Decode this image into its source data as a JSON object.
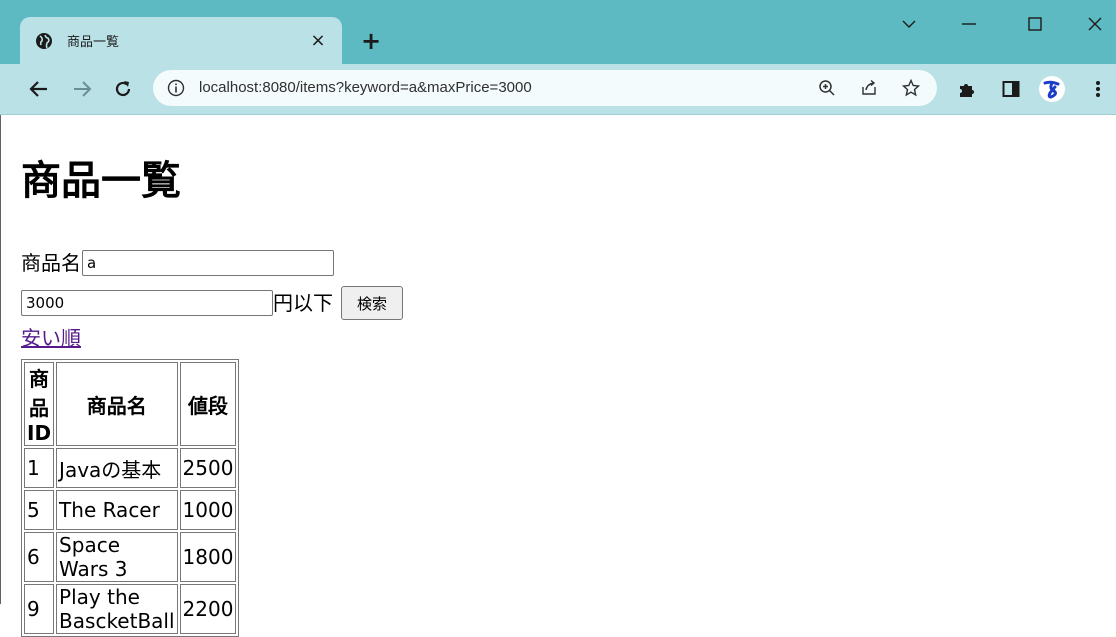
{
  "browser": {
    "tab_title": "商品一覧",
    "tab_close": "×",
    "new_tab": "+",
    "url": "localhost:8080/items?keyword=a&maxPrice=3000",
    "icons": [
      "globe-icon",
      "close-icon",
      "plus-icon",
      "chevron-down-icon",
      "minimize-icon",
      "maximize-icon",
      "window-close-icon",
      "back-arrow-icon",
      "forward-arrow-icon",
      "reload-icon",
      "info-icon",
      "zoom-icon",
      "share-icon",
      "star-icon",
      "puzzle-icon",
      "side-panel-icon",
      "profile-icon",
      "kebab-menu-icon"
    ],
    "colors": {
      "tabbar": "#5db9c2",
      "toolbar": "#b9e1e6",
      "omnibox": "#f3fbfc"
    }
  },
  "page": {
    "title": "商品一覧",
    "form": {
      "keyword_label": "商品名",
      "keyword_value": "a",
      "price_value": "3000",
      "price_suffix": "円以下",
      "search_label": "検索"
    },
    "sort_link": "安い順",
    "link_color": "#551a8b",
    "table": {
      "headers": [
        "商品ID",
        "商品名",
        "値段"
      ],
      "rows": [
        [
          "1",
          "Javaの基本",
          "2500"
        ],
        [
          "5",
          "The Racer",
          "1000"
        ],
        [
          "6",
          "Space Wars 3",
          "1800"
        ],
        [
          "9",
          "Play the BascketBall",
          "2200"
        ]
      ]
    }
  }
}
